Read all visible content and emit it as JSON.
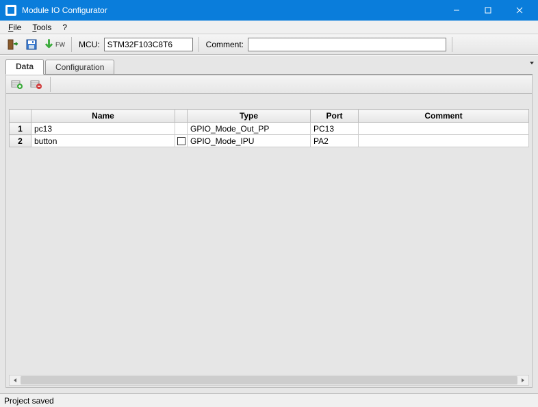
{
  "window": {
    "title": "Module IO Configurator"
  },
  "menu": {
    "file": "File",
    "tools": "Tools",
    "help": "?"
  },
  "toolbar": {
    "mcu_label": "MCU:",
    "mcu_value": "STM32F103C8T6",
    "comment_label": "Comment:",
    "comment_value": "",
    "fw_label": "FW"
  },
  "tabs": {
    "data": "Data",
    "configuration": "Configuration"
  },
  "grid": {
    "headers": {
      "name": "Name",
      "type": "Type",
      "port": "Port",
      "comment": "Comment"
    },
    "rows": [
      {
        "num": "1",
        "name": "pc13",
        "checked": false,
        "type": "GPIO_Mode_Out_PP",
        "port": "PC13",
        "comment": ""
      },
      {
        "num": "2",
        "name": "button",
        "checked": false,
        "type": "GPIO_Mode_IPU",
        "port": "PA2",
        "comment": ""
      }
    ]
  },
  "status": {
    "text": "Project saved"
  }
}
